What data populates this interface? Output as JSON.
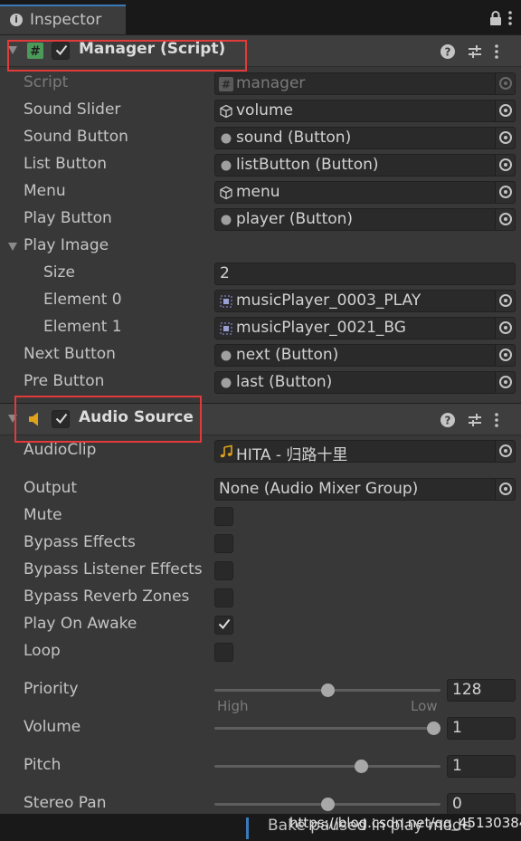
{
  "window": {
    "tab_label": "Inspector"
  },
  "manager": {
    "title": "Manager (Script)",
    "rows": {
      "script": {
        "label": "Script",
        "value": "manager"
      },
      "sound_slider": {
        "label": "Sound Slider",
        "value": "volume"
      },
      "sound_button": {
        "label": "Sound Button",
        "value": "sound (Button)"
      },
      "list_button": {
        "label": "List Button",
        "value": "listButton (Button)"
      },
      "menu": {
        "label": "Menu",
        "value": "menu"
      },
      "play_button": {
        "label": "Play Button",
        "value": "player (Button)"
      },
      "play_image": {
        "label": "Play Image"
      },
      "size": {
        "label": "Size",
        "value": "2"
      },
      "element0": {
        "label": "Element 0",
        "value": "musicPlayer_0003_PLAY"
      },
      "element1": {
        "label": "Element 1",
        "value": "musicPlayer_0021_BG"
      },
      "next_button": {
        "label": "Next Button",
        "value": "next (Button)"
      },
      "pre_button": {
        "label": "Pre Button",
        "value": "last (Button)"
      }
    }
  },
  "audio_source": {
    "title": "Audio Source",
    "rows": {
      "audio_clip": {
        "label": "AudioClip",
        "value": "HITA - 归路十里"
      },
      "output": {
        "label": "Output",
        "value": "None (Audio Mixer Group)"
      },
      "mute": {
        "label": "Mute",
        "checked": false
      },
      "bypass_effects": {
        "label": "Bypass Effects",
        "checked": false
      },
      "bypass_listener": {
        "label": "Bypass Listener Effects",
        "checked": false
      },
      "bypass_reverb": {
        "label": "Bypass Reverb Zones",
        "checked": false
      },
      "play_on_awake": {
        "label": "Play On Awake",
        "checked": true
      },
      "loop": {
        "label": "Loop",
        "checked": false
      },
      "priority": {
        "label": "Priority",
        "value": "128",
        "level": 0.5,
        "min_label": "High",
        "max_label": "Low"
      },
      "volume": {
        "label": "Volume",
        "value": "1",
        "level": 1.0
      },
      "pitch": {
        "label": "Pitch",
        "value": "1",
        "level": 0.66
      },
      "stereo_pan": {
        "label": "Stereo Pan",
        "value": "0",
        "level": 0.5
      }
    }
  },
  "status": {
    "text": "Bake paused in play mode"
  },
  "watermark": "https://blog.csdn.net/qq_45130384",
  "colors": {
    "accent": "#3a79bb",
    "highlight": "#e23a3a",
    "script_icon": "#4c9a5a",
    "audio_icon": "#e0a21a"
  }
}
